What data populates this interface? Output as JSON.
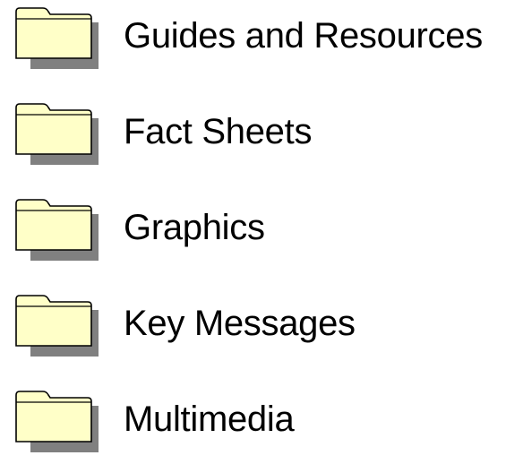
{
  "colors": {
    "folder_fill": "#ffffc8",
    "folder_outline": "#000000",
    "folder_shadow": "#808080",
    "text": "#000000",
    "background": "#ffffff"
  },
  "folders": [
    {
      "label": "Guides and Resources",
      "icon": "folder-icon"
    },
    {
      "label": "Fact Sheets",
      "icon": "folder-icon"
    },
    {
      "label": "Graphics",
      "icon": "folder-icon"
    },
    {
      "label": "Key Messages",
      "icon": "folder-icon"
    },
    {
      "label": "Multimedia",
      "icon": "folder-icon"
    }
  ]
}
